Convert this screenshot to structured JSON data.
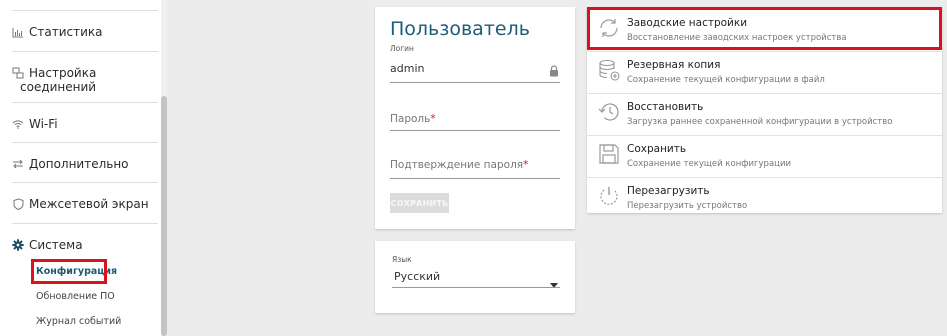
{
  "sidebar": {
    "items": [
      {
        "label": "Статистика",
        "icon": "bar-chart-icon"
      },
      {
        "label": "Настройка",
        "label2": "соединений",
        "icon": "connections-icon"
      },
      {
        "label": "Wi-Fi",
        "icon": "wifi-icon"
      },
      {
        "label": "Дополнительно",
        "icon": "arrows-icon"
      },
      {
        "label": "Межсетевой экран",
        "icon": "shield-icon"
      },
      {
        "label": "Система",
        "icon": "gear-icon"
      }
    ],
    "sub_items": [
      {
        "label": "Конфигурация",
        "active": true
      },
      {
        "label": "Обновление ПО"
      },
      {
        "label": "Журнал событий"
      }
    ]
  },
  "user_card": {
    "title": "Пользователь",
    "login_label": "Логин",
    "login_value": "admin",
    "password_placeholder": "Пароль",
    "confirm_placeholder": "Подтверждение пароля",
    "required_mark": "*",
    "save_label": "СОХРАНИТЬ"
  },
  "lang_card": {
    "label": "Язык",
    "value": "Русский"
  },
  "actions": [
    {
      "title": "Заводские настройки",
      "subtitle": "Восстановление заводских настроек устройства",
      "icon": "reset-icon"
    },
    {
      "title": "Резервная копия",
      "subtitle": "Сохранение текущей конфигурации в файл",
      "icon": "database-icon"
    },
    {
      "title": "Восстановить",
      "subtitle": "Загрузка раннее сохраненной конфигурации в устройство",
      "icon": "restore-icon"
    },
    {
      "title": "Сохранить",
      "subtitle": "Сохранение текущей конфигурации",
      "icon": "floppy-icon"
    },
    {
      "title": "Перезагрузить",
      "subtitle": "Перезагрузить устройство",
      "icon": "power-icon"
    }
  ],
  "colors": {
    "accent": "#1b5d78",
    "highlight": "#d9131e"
  }
}
